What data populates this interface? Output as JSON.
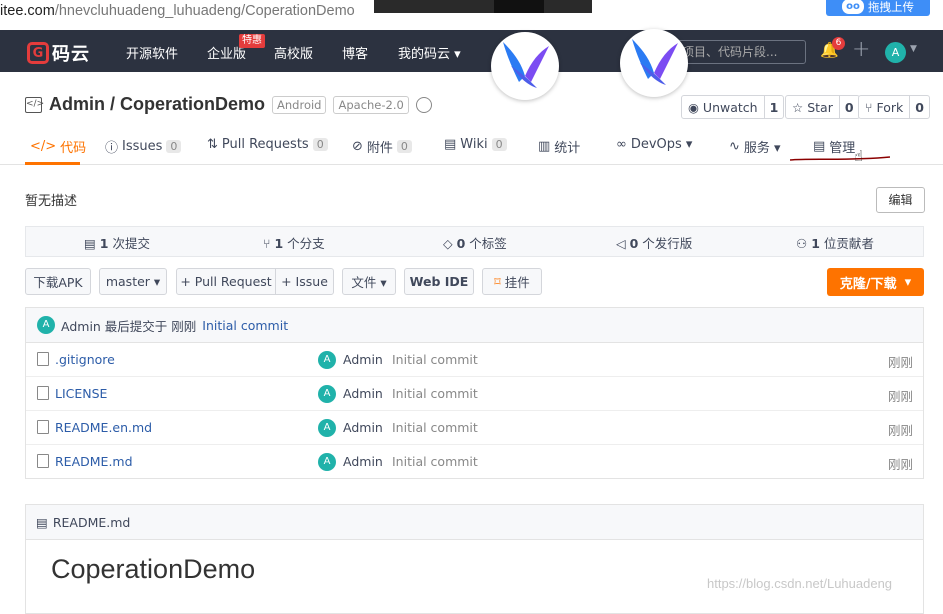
{
  "browser": {
    "url_host": "itee.com",
    "url_path": "/hnevcluhuadeng_luhuadeng/CoperationDemo",
    "drag_upload_label": "拖拽上传"
  },
  "nav": {
    "logo_glyph": "G",
    "logo_text": "码云",
    "items": [
      "开源软件",
      "企业版",
      "高校版",
      "博客",
      "我的码云 ▾"
    ],
    "hot_badge": "特惠",
    "search_placeholder": "项目、代码片段...",
    "notification_count": "6",
    "avatar_letter": "A"
  },
  "repo": {
    "owner_repo": "Admin / CoperationDemo",
    "tags": [
      "Android",
      "Apache-2.0"
    ],
    "watch": {
      "label": "Unwatch",
      "count": "1"
    },
    "star": {
      "label": "Star",
      "count": "0"
    },
    "fork": {
      "label": "Fork",
      "count": "0"
    }
  },
  "tabs": [
    {
      "label": "代码",
      "icon": "code-icon",
      "active": true
    },
    {
      "label": "Issues",
      "count": "0",
      "icon": "issue-icon"
    },
    {
      "label": "Pull Requests",
      "count": "0",
      "icon": "pr-icon"
    },
    {
      "label": "附件",
      "count": "0",
      "icon": "attachment-icon"
    },
    {
      "label": "Wiki",
      "count": "0",
      "icon": "wiki-icon"
    },
    {
      "label": "统计",
      "icon": "stats-icon"
    },
    {
      "label": "DevOps ▾",
      "icon": "devops-icon"
    },
    {
      "label": "服务 ▾",
      "icon": "service-icon"
    },
    {
      "label": "管理",
      "icon": "settings-icon"
    }
  ],
  "description": "暂无描述",
  "edit_label": "编辑",
  "stats": {
    "commits": {
      "num": "1",
      "label": " 次提交"
    },
    "branches": {
      "num": "1",
      "label": " 个分支"
    },
    "tags": {
      "num": "0",
      "label": " 个标签"
    },
    "releases": {
      "num": "0",
      "label": " 个发行版"
    },
    "contributors": {
      "num": "1",
      "label": " 位贡献者"
    }
  },
  "buttons": {
    "download_apk": "下载APK",
    "branch": "master ▾",
    "pull_request": "+ Pull Request",
    "issue": "+ Issue",
    "files": "文件 ▾",
    "web_ide": "Web IDE",
    "widget": "挂件",
    "clone": "克隆/下载",
    "clone_caret": "▾"
  },
  "last_commit": {
    "avatar": "A",
    "text": "Admin 最后提交于 刚刚",
    "message": "Initial commit"
  },
  "files": [
    {
      "name": ".gitignore",
      "user": "Admin",
      "message": "Initial commit",
      "time": "刚刚",
      "avatar": "A"
    },
    {
      "name": "LICENSE",
      "user": "Admin",
      "message": "Initial commit",
      "time": "刚刚",
      "avatar": "A"
    },
    {
      "name": "README.en.md",
      "user": "Admin",
      "message": "Initial commit",
      "time": "刚刚",
      "avatar": "A"
    },
    {
      "name": "README.md",
      "user": "Admin",
      "message": "Initial commit",
      "time": "刚刚",
      "avatar": "A"
    }
  ],
  "readme": {
    "filename": "README.md",
    "heading": "CoperationDemo"
  },
  "watermark": "https://blog.csdn.net/Luhuadeng",
  "colors": {
    "nav_bg": "#2c3240",
    "accent": "#fe7300",
    "brand_red": "#e43c3c",
    "link": "#2c5ca8"
  }
}
